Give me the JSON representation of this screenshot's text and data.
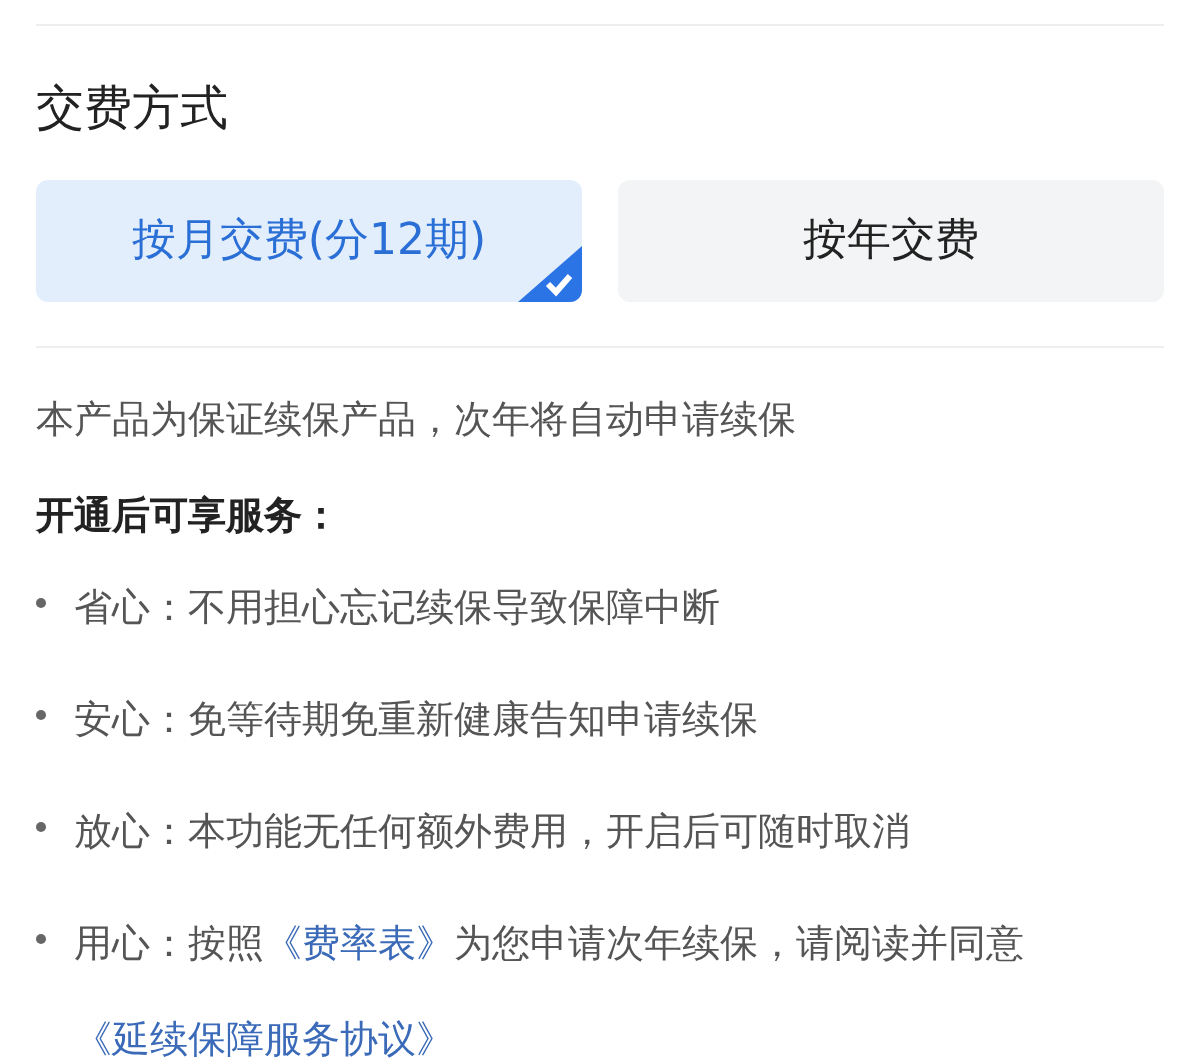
{
  "section_title": "交费方式",
  "payment_options": [
    {
      "label": "按月交费(分12期)",
      "selected": true
    },
    {
      "label": "按年交费",
      "selected": false
    }
  ],
  "note": "本产品为保证续保产品，次年将自动申请续保",
  "services_title": "开通后可享服务：",
  "services": [
    {
      "segments": [
        {
          "kind": "plain",
          "text": "省心：不用担心忘记续保导致保障中断"
        }
      ]
    },
    {
      "segments": [
        {
          "kind": "plain",
          "text": "安心：免等待期免重新健康告知申请续保"
        }
      ]
    },
    {
      "segments": [
        {
          "kind": "plain",
          "text": "放心：本功能无任何额外费用，开启后可随时取消"
        }
      ]
    },
    {
      "segments": [
        {
          "kind": "plain",
          "text": "用心：按照"
        },
        {
          "kind": "link",
          "text": "《费率表》"
        },
        {
          "kind": "plain",
          "text": "为您申请次年续保，请阅读并同意"
        },
        {
          "kind": "link",
          "text": "《延续保障服务协议》"
        }
      ]
    }
  ]
}
